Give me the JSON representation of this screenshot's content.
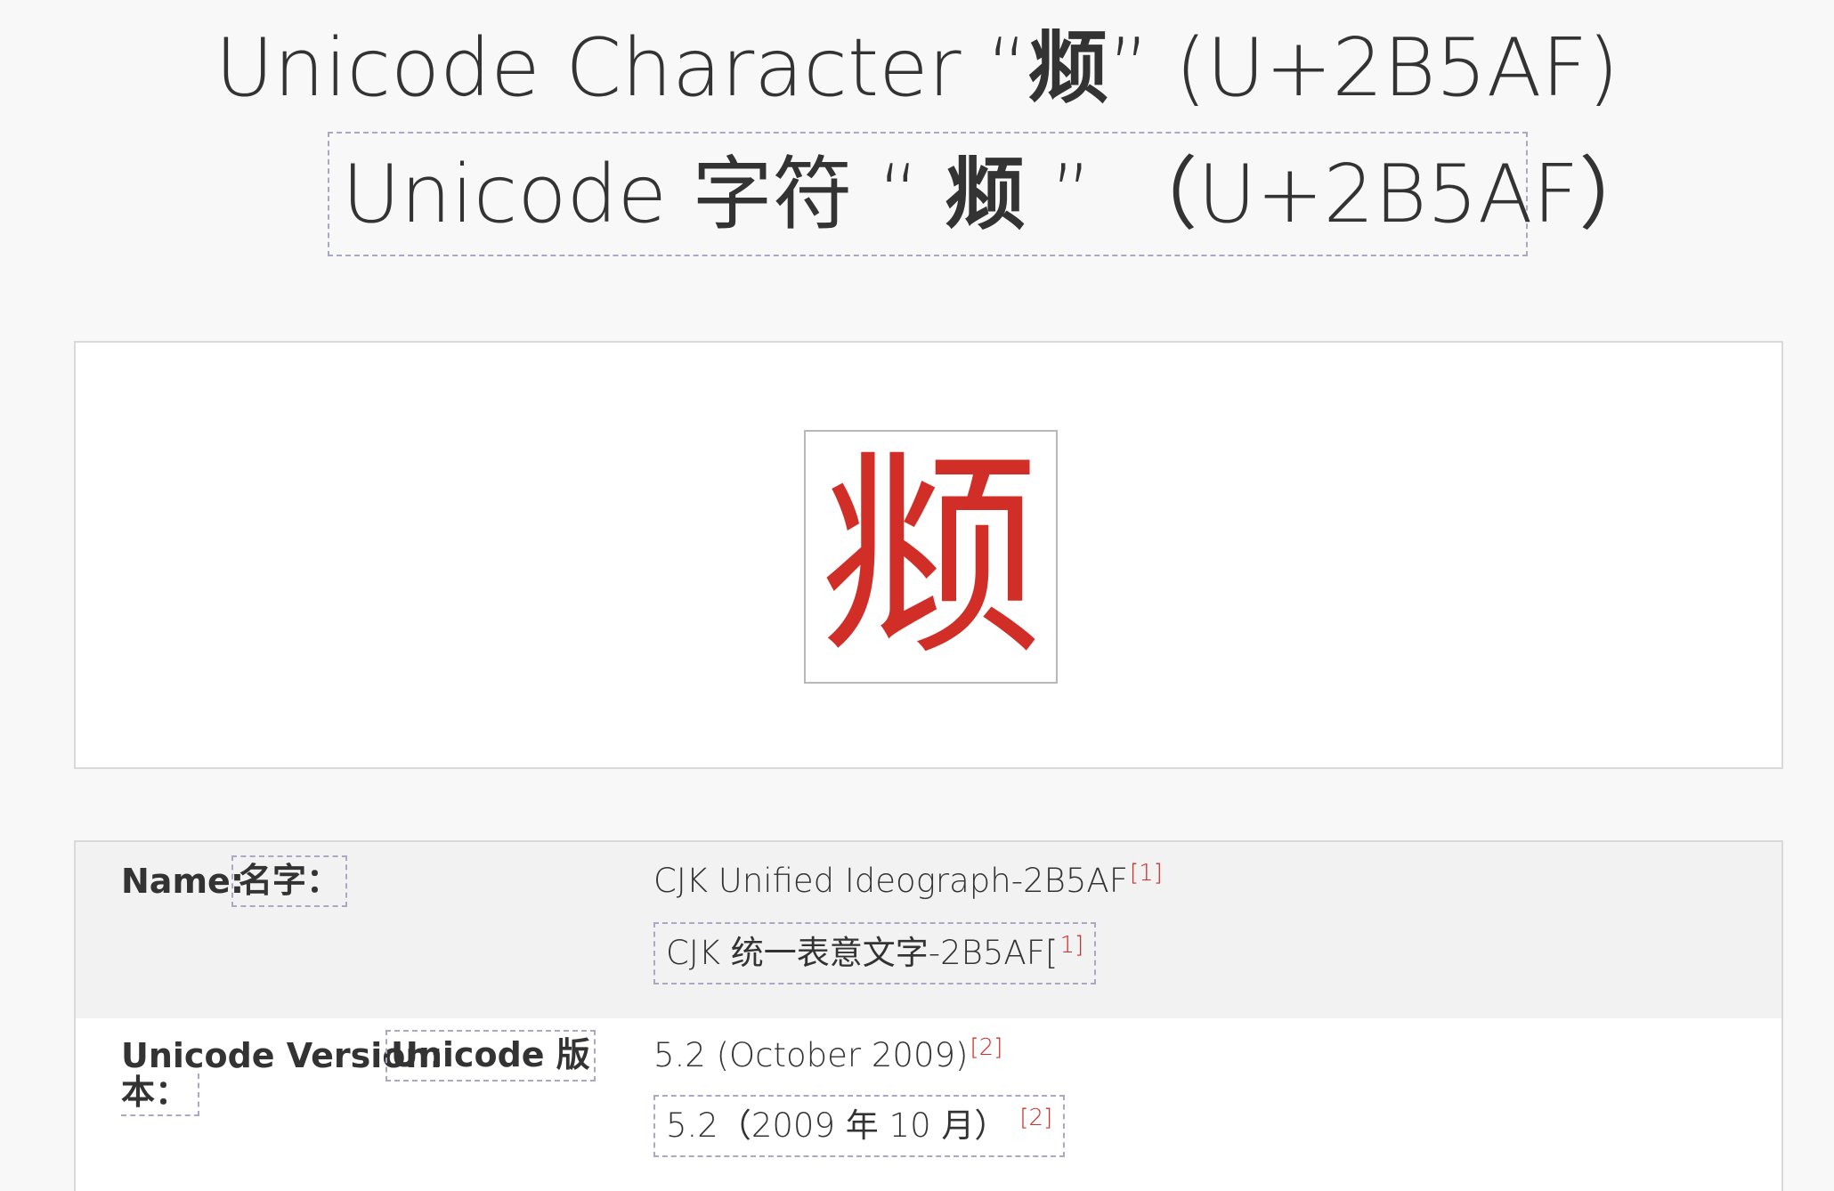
{
  "title": {
    "en_prefix": "Unicode Character “",
    "en_char": "𫖯",
    "en_suffix": "” (U+2B5AF)",
    "zh_prefix": "Unicode 字符 “ ",
    "zh_char": "𫖯",
    "zh_suffix": " ” （U+2B5AF）"
  },
  "glyph": {
    "char": "𫖯",
    "color": "#d12e28"
  },
  "info": {
    "name": {
      "label_en": "Name:",
      "label_zh": "名字：",
      "value_en": "CJK Unified Ideograph-2B5AF",
      "value_en_ref": "[1]",
      "value_zh": "CJK 统一表意文字-2B5AF[",
      "value_zh_ref": "1]"
    },
    "version": {
      "label_en": "Unicode Version:",
      "label_zh_line1": "Unicode 版",
      "label_zh_line2": "本：",
      "value_en": "5.2 (October 2009)",
      "value_en_ref": "[2]",
      "value_zh": "5.2（2009 年 10 月）",
      "value_zh_ref": "[2]"
    }
  }
}
